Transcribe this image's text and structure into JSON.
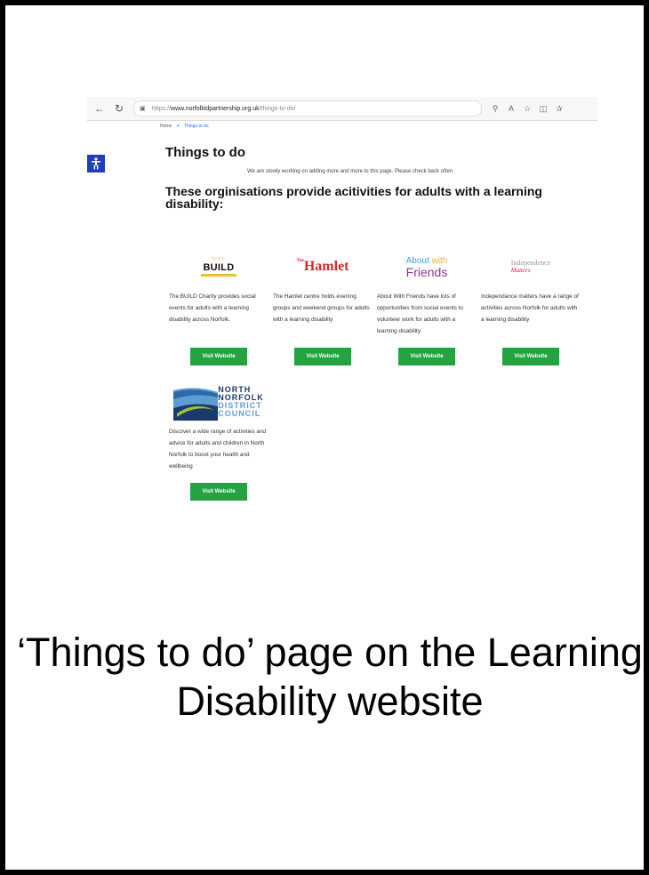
{
  "browser": {
    "url_protocol": "https://",
    "url_domain": "www.norfolkldpartnership.org.uk",
    "url_path": "/things-to-do/"
  },
  "breadcrumb": {
    "home": "Home",
    "separator": ">",
    "current": "Things to do"
  },
  "page": {
    "title": "Things to do",
    "notice": "We are slowly working on adding more and more to this page. Please check back often",
    "subheading": "These orginisations provide acitivities for adults with a learning disability:"
  },
  "cards": [
    {
      "logo": {
        "top": "ΓΓΓΓ",
        "word": "BUILD"
      },
      "description": "The BUILD Charity provides social events for adults with a learning disability across Norfolk.",
      "button": "Visit Website"
    },
    {
      "logo": {
        "the": "The",
        "word": "Hamlet"
      },
      "description": "The Hamlet centre holds evening groups and weekend groups for adults with a learning disability",
      "button": "Visit Website"
    },
    {
      "logo": {
        "line1a": "About ",
        "line1b": "with",
        "line2": "Friends"
      },
      "description": "About With Friends have lots of opportunities from social events to volunteer work for adults with a learning disability",
      "button": "Visit Website"
    },
    {
      "logo": {
        "line1": "Independence",
        "line2": "Matters"
      },
      "description": "Independance matters have a range of activities across Norfolk for adults with a learning disability",
      "button": "Visit Website"
    },
    {
      "logo": {
        "l1": "NORTH",
        "l2": "NORFOLK",
        "l3": "DISTRICT",
        "l4": "COUNCIL"
      },
      "description": "Discover a wide range of activities and advice for adults and children in North Norfolk to boost your health and wellbeing",
      "button": "Visit Website"
    }
  ],
  "caption": "‘Things to do’ page on the Learning Disability website",
  "colors": {
    "button": "#23a441",
    "accessibility": "#1f3fbf",
    "link": "#1a73e8"
  }
}
